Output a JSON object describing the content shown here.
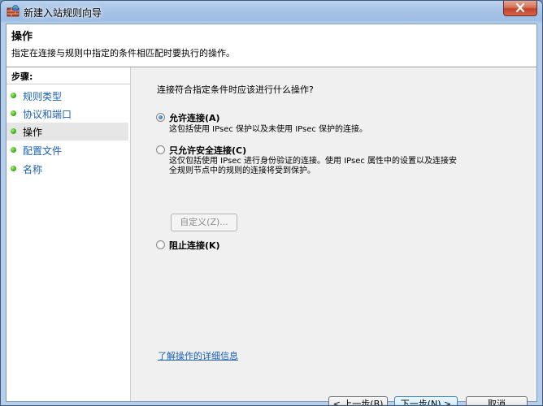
{
  "window": {
    "title": "新建入站规则向导"
  },
  "header": {
    "title": "操作",
    "description": "指定在连接与规则中指定的条件相匹配时要执行的操作。"
  },
  "sidebar": {
    "steps_label": "步骤:",
    "items": [
      {
        "label": "规则类型"
      },
      {
        "label": "协议和端口"
      },
      {
        "label": "操作"
      },
      {
        "label": "配置文件"
      },
      {
        "label": "名称"
      }
    ],
    "active_index": 2
  },
  "main": {
    "question": "连接符合指定条件时应该进行什么操作?",
    "options": [
      {
        "label": "允许连接(A)",
        "description": "这包括使用 IPsec 保护以及未使用 IPsec 保护的连接。",
        "checked": true
      },
      {
        "label": "只允许安全连接(C)",
        "description_line1": "这仅包括使用 IPsec 进行身份验证的连接。使用 IPsec 属性中的设置以及连接安",
        "description_line2": "全规则节点中的规则的连接将受到保护。",
        "checked": false
      },
      {
        "label": "阻止连接(K)",
        "checked": false
      }
    ],
    "custom_button": "自定义(Z)...",
    "learn_more_link": "了解操作的详细信息"
  },
  "buttons": {
    "back": "< 上一步(B)",
    "next": "下一步(N) >",
    "cancel": "取消"
  },
  "colors": {
    "link": "#1a5fb4",
    "title_bar": "#a9c5e7",
    "close_button": "#c2412a",
    "step_bullet": "#3cb01d"
  },
  "icons": {
    "window_icon": "firewall-icon",
    "close": "close-icon",
    "step_bullet": "green-dot-icon"
  }
}
